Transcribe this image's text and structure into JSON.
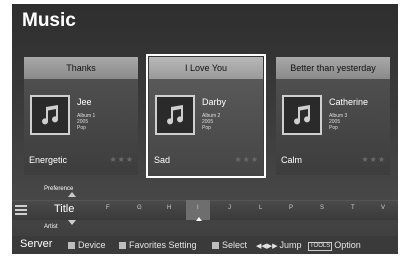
{
  "screen_title": "Music",
  "cards": [
    {
      "title": "Thanks",
      "artist": "Jee",
      "album": "Album 1",
      "year": "2005",
      "genre": "Pop",
      "mood": "Energetic",
      "stars": "★★★"
    },
    {
      "title": "I Love You",
      "artist": "Darby",
      "album": "Album 2",
      "year": "2005",
      "genre": "Pop",
      "mood": "Sad",
      "stars": "★★★"
    },
    {
      "title": "Better than yesterday",
      "artist": "Catherine",
      "album": "Album 3",
      "year": "2005",
      "genre": "Pop",
      "mood": "Calm",
      "stars": "★★★"
    }
  ],
  "sort": {
    "above": "Preference",
    "current": "Title",
    "below": "Artist"
  },
  "letters": [
    "F",
    "G",
    "H",
    "I",
    "J",
    "L",
    "P",
    "S",
    "T",
    "V"
  ],
  "bottom": {
    "server": "Server",
    "device": "Device",
    "favorites": "Favorites Setting",
    "select": "Select",
    "jump_icon": "◀◀▶▶",
    "jump": "Jump",
    "tools": "TOOLS",
    "option": "Option"
  }
}
